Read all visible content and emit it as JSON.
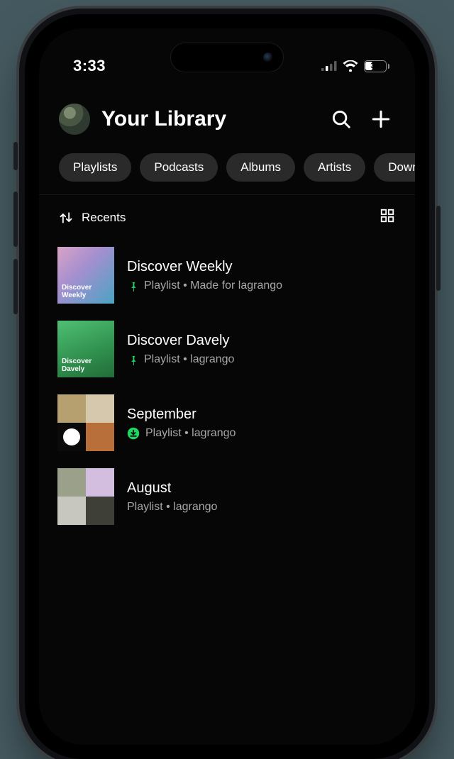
{
  "status": {
    "time": "3:33",
    "battery": "33"
  },
  "header": {
    "title": "Your Library"
  },
  "chips": [
    "Playlists",
    "Podcasts",
    "Albums",
    "Artists",
    "Downloaded"
  ],
  "sort": {
    "label": "Recents"
  },
  "items": [
    {
      "title": "Discover Weekly",
      "subtitle": "Playlist • Made for lagrango",
      "badge": "pin"
    },
    {
      "title": "Discover Davely",
      "subtitle": "Playlist • lagrango",
      "badge": "pin"
    },
    {
      "title": "September",
      "subtitle": "Playlist • lagrango",
      "badge": "download"
    },
    {
      "title": "August",
      "subtitle": "Playlist • lagrango",
      "badge": "none"
    }
  ]
}
